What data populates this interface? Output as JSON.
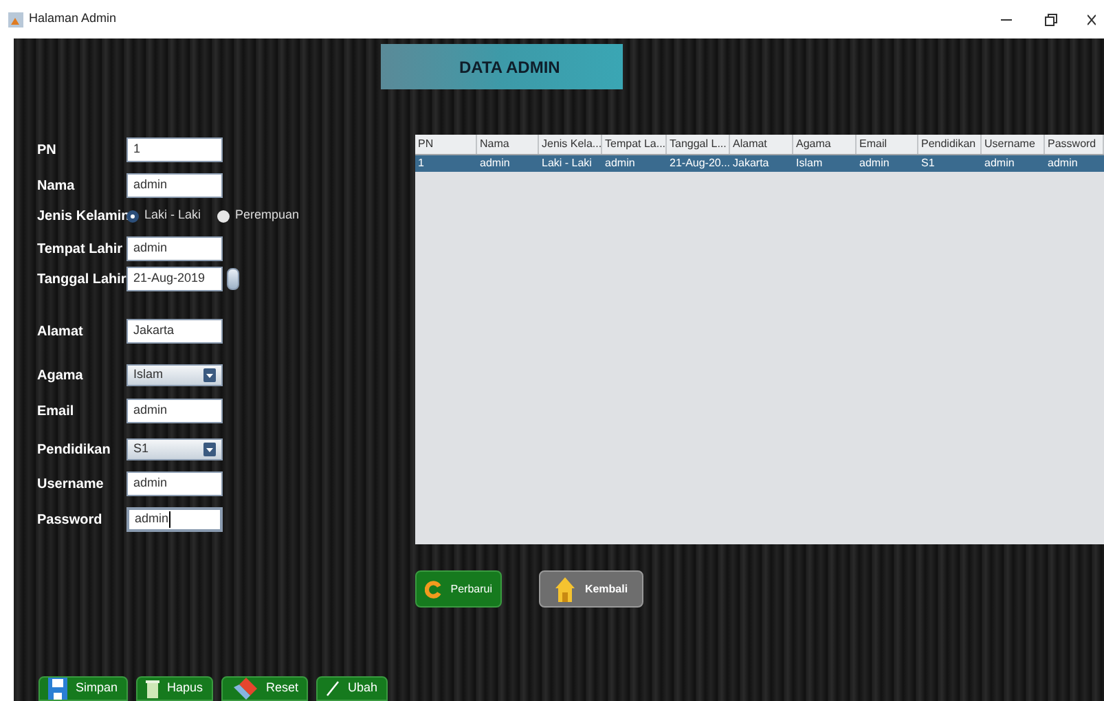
{
  "window": {
    "title": "Halaman Admin"
  },
  "banner": {
    "title": "DATA ADMIN"
  },
  "form": [
    {
      "label": "PN",
      "kind": "text",
      "value": "1"
    },
    {
      "label": "Nama",
      "kind": "text",
      "value": "admin"
    },
    {
      "label": "Jenis Kelamin",
      "kind": "radio",
      "options": [
        {
          "label": "Laki - Laki",
          "selected": true
        },
        {
          "label": "Perempuan",
          "selected": false
        }
      ]
    },
    {
      "label": "Tempat Lahir",
      "kind": "text",
      "value": "admin"
    },
    {
      "label": "Tanggal Lahir",
      "kind": "spinner",
      "value": "21-Aug-2019"
    },
    {
      "label": "Alamat",
      "kind": "text",
      "value": "Jakarta"
    },
    {
      "label": "Agama",
      "kind": "select",
      "value": "Islam"
    },
    {
      "label": "Email",
      "kind": "text",
      "value": "admin"
    },
    {
      "label": "Pendidikan",
      "kind": "select",
      "value": "S1"
    },
    {
      "label": "Username",
      "kind": "text",
      "value": "admin"
    },
    {
      "label": "Password",
      "kind": "text",
      "value": "admin",
      "focused": true
    }
  ],
  "table": {
    "columns": [
      "PN",
      "Nama",
      "Jenis Kela...",
      "Tempat La...",
      "Tanggal L...",
      "Alamat",
      "Agama",
      "Email",
      "Pendidikan",
      "Username",
      "Password"
    ],
    "rows": [
      {
        "selected": true,
        "cells": [
          "1",
          "admin",
          "Laki - Laki",
          "admin",
          "21-Aug-20...",
          "Jakarta",
          "Islam",
          "admin",
          "S1",
          "admin",
          "admin"
        ]
      }
    ]
  },
  "actions": [
    {
      "label": "Perbarui",
      "kind": "refresh"
    },
    {
      "label": "Kembali",
      "kind": "home"
    }
  ],
  "bottom_buttons": [
    {
      "label": "Simpan",
      "kind": "save"
    },
    {
      "label": "Hapus",
      "kind": "delete"
    },
    {
      "label": "Reset",
      "kind": "reset"
    },
    {
      "label": "Ubah",
      "kind": "edit"
    }
  ]
}
